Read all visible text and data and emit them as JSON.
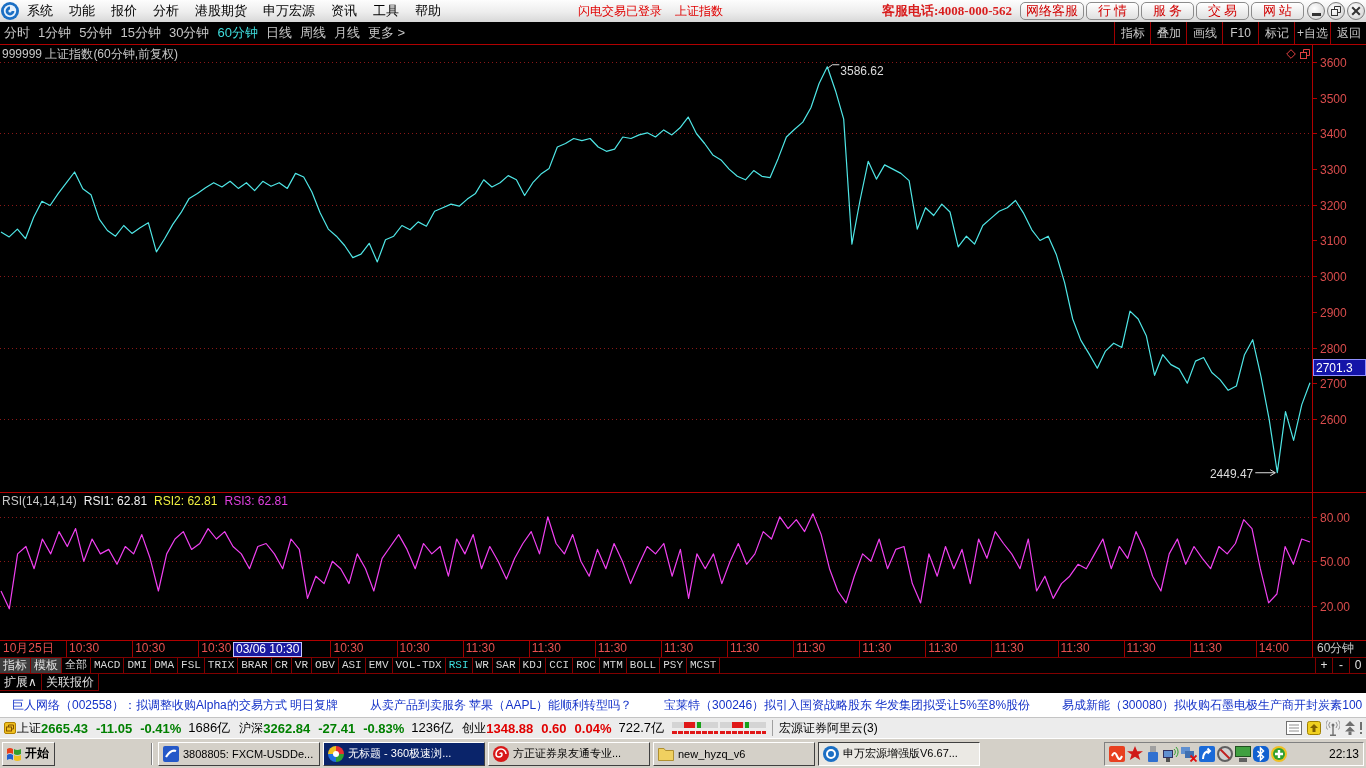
{
  "title_bar": {
    "menus": [
      "系统",
      "功能",
      "报价",
      "分析",
      "港股期货",
      "申万宏源",
      "资讯",
      "工具",
      "帮助"
    ],
    "login_status": "闪电交易已登录",
    "security": "上证指数",
    "hotline": "客服电话:4008-000-562",
    "links": [
      "网络客服",
      "行 情",
      "服 务",
      "交 易",
      "网 站"
    ]
  },
  "period_bar": {
    "periods": [
      {
        "label": "分时",
        "selected": false
      },
      {
        "label": "1分钟",
        "selected": false
      },
      {
        "label": "5分钟",
        "selected": false
      },
      {
        "label": "15分钟",
        "selected": false
      },
      {
        "label": "30分钟",
        "selected": false
      },
      {
        "label": "60分钟",
        "selected": true
      },
      {
        "label": "日线",
        "selected": false
      },
      {
        "label": "周线",
        "selected": false
      },
      {
        "label": "月线",
        "selected": false
      }
    ],
    "more": "更多 >",
    "tools": [
      "指标",
      "叠加",
      "画线",
      "F10",
      "标记",
      "+自选",
      "返回"
    ]
  },
  "price_panel": {
    "title": "999999 上证指数(60分钟,前复权)",
    "last_price": "2701.3",
    "chart_data": {
      "type": "line",
      "ylim": [
        2395,
        3648
      ],
      "yticks": [
        2600,
        2700,
        2800,
        2900,
        3000,
        3100,
        3200,
        3300,
        3400,
        3500,
        3600
      ],
      "grid": true,
      "series": [
        {
          "color": "#4fe6e6",
          "values": [
            3124,
            3110,
            3132,
            3105,
            3165,
            3210,
            3198,
            3232,
            3262,
            3292,
            3245,
            3228,
            3160,
            3128,
            3112,
            3142,
            3120,
            3136,
            3150,
            3068,
            3105,
            3145,
            3178,
            3218,
            3232,
            3248,
            3262,
            3250,
            3266,
            3246,
            3262,
            3240,
            3266,
            3252,
            3262,
            3246,
            3288,
            3278,
            3236,
            3178,
            3132,
            3112,
            3086,
            3052,
            3062,
            3092,
            3040,
            3102,
            3112,
            3142,
            3130,
            3152,
            3140,
            3182,
            3192,
            3202,
            3196,
            3216,
            3232,
            3270,
            3250,
            3262,
            3282,
            3270,
            3226,
            3262,
            3286,
            3302,
            3362,
            3372,
            3386,
            3380,
            3386,
            3362,
            3350,
            3356,
            3390,
            3386,
            3396,
            3402,
            3390,
            3410,
            3396,
            3416,
            3446,
            3400,
            3372,
            3340,
            3326,
            3300,
            3280,
            3270,
            3296,
            3280,
            3276,
            3330,
            3390,
            3412,
            3432,
            3472,
            3540,
            3587,
            3520,
            3440,
            3090,
            3212,
            3322,
            3272,
            3312,
            3300,
            3288,
            3268,
            3132,
            3192,
            3170,
            3202,
            3180,
            3082,
            3112,
            3090,
            3142,
            3162,
            3182,
            3192,
            3212,
            3176,
            3130,
            3100,
            3112,
            3060,
            2982,
            2880,
            2820,
            2782,
            2742,
            2790,
            2812,
            2800,
            2902,
            2880,
            2832,
            2722,
            2780,
            2752,
            2740,
            2700,
            2762,
            2772,
            2730,
            2710,
            2680,
            2692,
            2780,
            2822,
            2720,
            2600,
            2449,
            2620,
            2540,
            2640,
            2701
          ]
        }
      ],
      "annotations": [
        "3586.62",
        "2449.47"
      ]
    }
  },
  "rsi_panel": {
    "title": "RSI(14,14,14)",
    "readings": [
      {
        "label": "RSI1: 62.81",
        "color": "#f0f0f0"
      },
      {
        "label": "RSI2: 62.81",
        "color": "#f0f040"
      },
      {
        "label": "RSI3: 62.81",
        "color": "#e040e0"
      }
    ],
    "chart_data": {
      "type": "line",
      "ylim": [
        -3,
        96
      ],
      "yticks": [
        {
          "value": 20,
          "label": "20.00"
        },
        {
          "value": 50,
          "label": "50.00"
        },
        {
          "value": 80,
          "label": "80.00"
        }
      ],
      "grid": true,
      "series": [
        {
          "color": "#f040f0",
          "values": [
            30,
            18,
            55,
            60,
            45,
            65,
            55,
            70,
            60,
            72,
            50,
            65,
            55,
            58,
            48,
            60,
            55,
            68,
            52,
            30,
            55,
            65,
            70,
            58,
            62,
            72,
            65,
            70,
            60,
            55,
            45,
            60,
            62,
            55,
            45,
            65,
            58,
            25,
            40,
            35,
            50,
            45,
            35,
            55,
            45,
            30,
            52,
            60,
            68,
            58,
            45,
            62,
            55,
            60,
            40,
            65,
            55,
            68,
            45,
            60,
            50,
            38,
            52,
            62,
            70,
            55,
            80,
            62,
            55,
            68,
            50,
            40,
            58,
            45,
            62,
            50,
            35,
            48,
            60,
            55,
            62,
            40,
            58,
            25,
            55,
            45,
            55,
            35,
            50,
            62,
            48,
            55,
            70,
            65,
            80,
            72,
            78,
            70,
            82,
            68,
            45,
            30,
            22,
            40,
            55,
            50,
            65,
            45,
            58,
            60,
            35,
            22,
            55,
            40,
            60,
            45,
            58,
            35,
            65,
            52,
            70,
            62,
            55,
            45,
            65,
            30,
            40,
            25,
            35,
            40,
            48,
            45,
            55,
            65,
            45,
            60,
            52,
            70,
            58,
            40,
            30,
            55,
            65,
            48,
            60,
            52,
            45,
            60,
            55,
            62,
            78,
            72,
            45,
            22,
            28,
            60,
            48,
            65,
            63
          ]
        }
      ]
    }
  },
  "time_axis": {
    "labels": [
      {
        "text": "10月25日",
        "kind": "tick"
      },
      {
        "text": "10:30",
        "kind": "tick"
      },
      {
        "text": "10:30",
        "kind": "tick"
      },
      {
        "text": "10:30",
        "kind": "tick"
      },
      {
        "text": "03/06 10:30",
        "kind": "cursor"
      },
      {
        "text": "10:30",
        "kind": "tick"
      },
      {
        "text": "10:30",
        "kind": "tick"
      },
      {
        "text": "11:30",
        "kind": "tick"
      },
      {
        "text": "11:30",
        "kind": "tick"
      },
      {
        "text": "11:30",
        "kind": "tick"
      },
      {
        "text": "11:30",
        "kind": "tick"
      },
      {
        "text": "11:30",
        "kind": "tick"
      },
      {
        "text": "11:30",
        "kind": "tick"
      },
      {
        "text": "11:30",
        "kind": "tick"
      },
      {
        "text": "11:30",
        "kind": "tick"
      },
      {
        "text": "11:30",
        "kind": "tick"
      },
      {
        "text": "11:30",
        "kind": "tick"
      },
      {
        "text": "11:30",
        "kind": "tick"
      },
      {
        "text": "11:30",
        "kind": "tick"
      },
      {
        "text": "14:00",
        "kind": "tick"
      }
    ],
    "period": "60分钟"
  },
  "indicator_bar": {
    "buttons": [
      "指标",
      "模板"
    ],
    "tabs": [
      {
        "label": "全部",
        "selected": false
      },
      {
        "label": "MACD",
        "selected": false
      },
      {
        "label": "DMI",
        "selected": false
      },
      {
        "label": "DMA",
        "selected": false
      },
      {
        "label": "FSL",
        "selected": false
      },
      {
        "label": "TRIX",
        "selected": false
      },
      {
        "label": "BRAR",
        "selected": false
      },
      {
        "label": "CR",
        "selected": false
      },
      {
        "label": "VR",
        "selected": false
      },
      {
        "label": "OBV",
        "selected": false
      },
      {
        "label": "ASI",
        "selected": false
      },
      {
        "label": "EMV",
        "selected": false
      },
      {
        "label": "VOL-TDX",
        "selected": false
      },
      {
        "label": "RSI",
        "selected": true
      },
      {
        "label": "WR",
        "selected": false
      },
      {
        "label": "SAR",
        "selected": false
      },
      {
        "label": "KDJ",
        "selected": false
      },
      {
        "label": "CCI",
        "selected": false
      },
      {
        "label": "ROC",
        "selected": false
      },
      {
        "label": "MTM",
        "selected": false
      },
      {
        "label": "BOLL",
        "selected": false
      },
      {
        "label": "PSY",
        "selected": false
      },
      {
        "label": "MCST",
        "selected": false
      }
    ],
    "zoom_buttons": [
      "+",
      "-",
      "0"
    ]
  },
  "extension_bar": {
    "items": [
      "扩展∧",
      "关联报价"
    ]
  },
  "news_ticker": {
    "items": [
      "巨人网络（002558）：拟调整收购Alpha的交易方式 明日复牌",
      "从卖产品到卖服务 苹果（AAPL）能顺利转型吗？",
      "宝莱特（300246）拟引入国资战略股东 华发集团拟受让5%至8%股份",
      "易成新能（300080）拟收购石墨电极生产商开封炭素100"
    ]
  },
  "status_bar": {
    "indices": [
      {
        "name": "上证",
        "price": "2665.43",
        "change": "-11.05",
        "percent": "-0.41%",
        "volume": "1686亿",
        "color": "#008000"
      },
      {
        "name": "沪深",
        "price": "3262.84",
        "change": "-27.41",
        "percent": "-0.83%",
        "volume": "1236亿",
        "color": "#008000"
      },
      {
        "name": "创业",
        "price": "1348.88",
        "change": "0.60",
        "percent": "0.04%",
        "volume": "722.7亿",
        "color": "#e00000"
      }
    ],
    "server": "宏源证券阿里云(3)"
  },
  "taskbar": {
    "start": "开始",
    "tasks": [
      {
        "label": "3808805: FXCM-USDDe...",
        "selected": false,
        "flashing": false
      },
      {
        "label": "无标题 - 360极速浏...",
        "selected": false,
        "flashing": true
      },
      {
        "label": "方正证券泉友通专业...",
        "selected": false,
        "flashing": false
      },
      {
        "label": "new_hyzq_v6",
        "selected": false,
        "flashing": false
      },
      {
        "label": "申万宏源增强版V6.67...",
        "selected": true,
        "flashing": false
      }
    ],
    "clock": "22:13"
  }
}
